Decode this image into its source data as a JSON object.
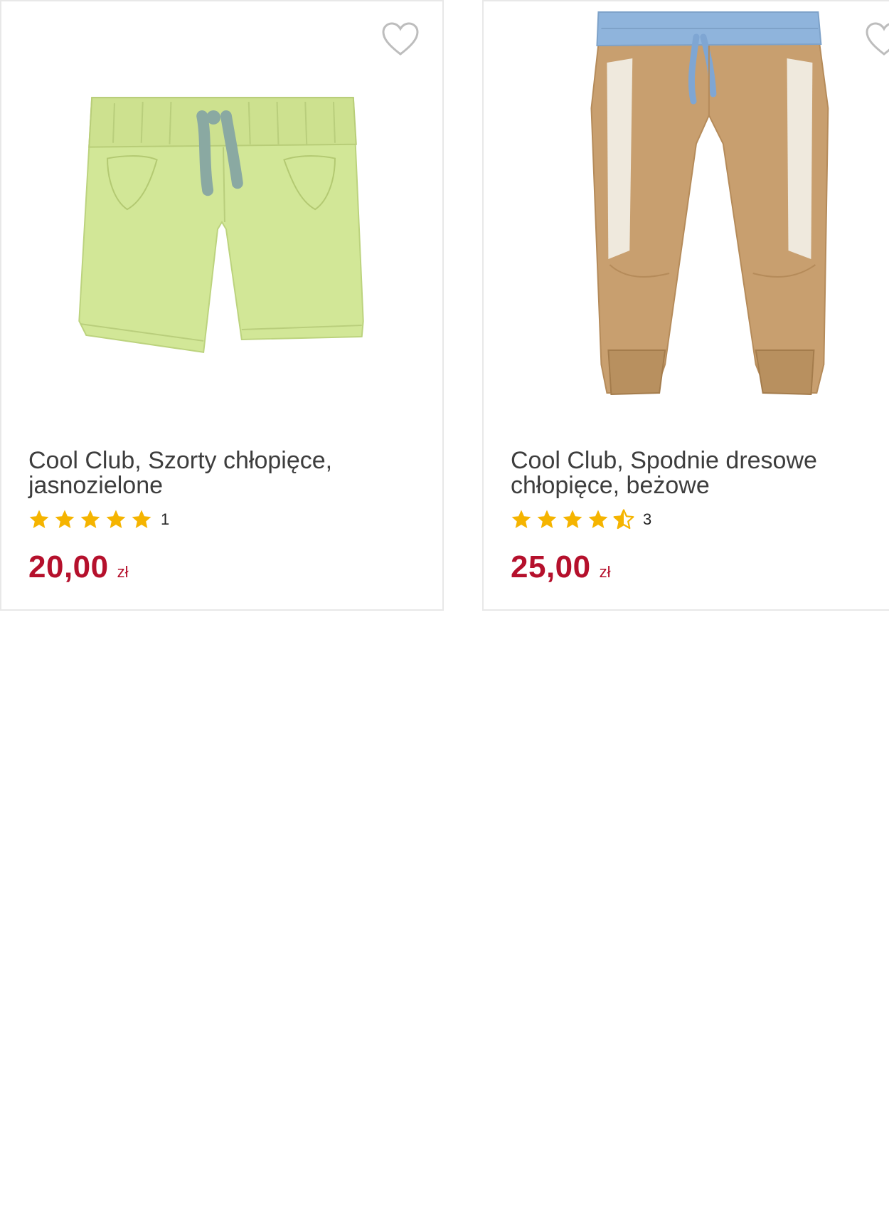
{
  "products": [
    {
      "title": "Cool Club, Szorty chłopięce, jasnozielone",
      "rating_count": "1",
      "rating_value": 5,
      "price_value": "20,00",
      "price_currency": "zł",
      "image_icon": "light-green-shorts-image"
    },
    {
      "title": "Cool Club, Spodnie dresowe chłopięce, beżowe",
      "rating_count": "3",
      "rating_value": 4.5,
      "price_value": "25,00",
      "price_currency": "zł",
      "image_icon": "beige-sweatpants-image"
    }
  ],
  "colors": {
    "price": "#b5102c",
    "star": "#f5b400",
    "heart_outline": "#bdbdbd",
    "card_border": "#e8e8e8"
  }
}
